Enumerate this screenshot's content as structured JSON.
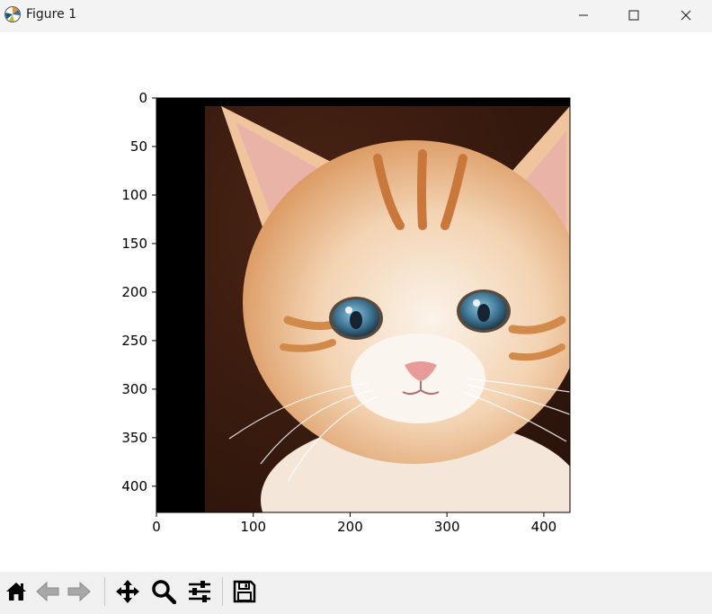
{
  "window": {
    "title": "Figure 1",
    "app_icon": "matplotlib-logo-icon",
    "controls": [
      "minimize-icon",
      "maximize-icon",
      "close-icon"
    ]
  },
  "chart_data": {
    "type": "image",
    "title": "",
    "xlabel": "",
    "ylabel": "",
    "image_size": [
      427,
      427
    ],
    "xlim": [
      0,
      427
    ],
    "ylim": [
      427,
      0
    ],
    "x_ticks": [
      0,
      100,
      200,
      300,
      400
    ],
    "y_ticks": [
      0,
      50,
      100,
      150,
      200,
      250,
      300,
      350,
      400
    ],
    "x_tick_labels": [
      "0",
      "100",
      "200",
      "300",
      "400"
    ],
    "y_tick_labels": [
      "0",
      "50",
      "100",
      "150",
      "200",
      "250",
      "300",
      "350",
      "400"
    ],
    "content": "photo of an orange tabby kitten with blue eyes, shifted right and down with black padding on the left and top",
    "padding_color": "#000000",
    "background_color": "#3b1d10"
  },
  "toolbar": {
    "buttons": [
      {
        "name": "home-button",
        "icon": "home-icon"
      },
      {
        "name": "back-button",
        "icon": "back-arrow-icon"
      },
      {
        "name": "forward-button",
        "icon": "forward-arrow-icon"
      },
      {
        "name": "pan-button",
        "icon": "pan-move-icon"
      },
      {
        "name": "zoom-button",
        "icon": "zoom-magnifier-icon"
      },
      {
        "name": "configure-subplots-button",
        "icon": "sliders-icon"
      },
      {
        "name": "save-button",
        "icon": "save-disk-icon"
      }
    ]
  }
}
